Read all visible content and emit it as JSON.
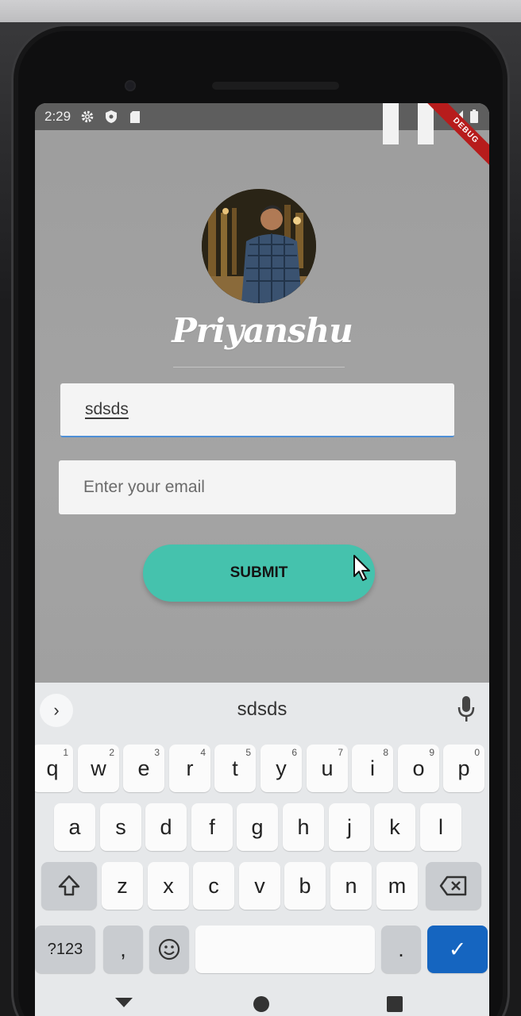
{
  "status_bar": {
    "time": "2:29",
    "debug_label": "DEBUG"
  },
  "profile": {
    "name": "Priyanshu"
  },
  "form": {
    "name_value": "sdsds",
    "email_placeholder": "Enter your email",
    "submit_label": "SUBMIT"
  },
  "keyboard": {
    "suggestion": "sdsds",
    "row1": [
      {
        "key": "q",
        "num": "1"
      },
      {
        "key": "w",
        "num": "2"
      },
      {
        "key": "e",
        "num": "3"
      },
      {
        "key": "r",
        "num": "4"
      },
      {
        "key": "t",
        "num": "5"
      },
      {
        "key": "y",
        "num": "6"
      },
      {
        "key": "u",
        "num": "7"
      },
      {
        "key": "i",
        "num": "8"
      },
      {
        "key": "o",
        "num": "9"
      },
      {
        "key": "p",
        "num": "0"
      }
    ],
    "row2": [
      "a",
      "s",
      "d",
      "f",
      "g",
      "h",
      "j",
      "k",
      "l"
    ],
    "row3": [
      "z",
      "x",
      "c",
      "v",
      "b",
      "n",
      "m"
    ],
    "symbols_label": "?123",
    "comma_label": ",",
    "period_label": ".",
    "done_symbol": "✓"
  },
  "colors": {
    "accent": "#45c2ad",
    "field_underline": "#4e8fd6",
    "done_key": "#1565c0",
    "debug_banner": "#b71c1c"
  }
}
